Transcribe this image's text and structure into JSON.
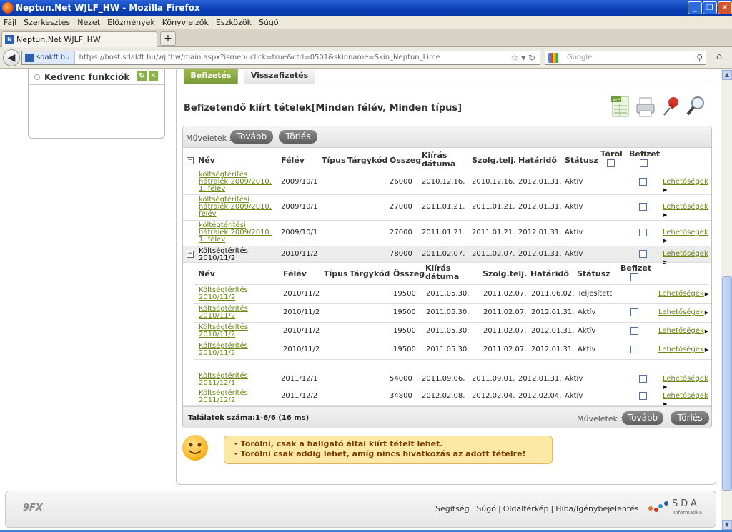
{
  "window": {
    "title": "Neptun.Net WJLF_HW - Mozilla Firefox"
  },
  "menu": [
    "Fájl",
    "Szerkesztés",
    "Nézet",
    "Előzmények",
    "Könyvjelzők",
    "Eszközök",
    "Súgó"
  ],
  "browser": {
    "tab_title": "Neptun.Net WJLF_HW",
    "new_tab": "+",
    "site_label": "sdakft.hu",
    "url": "https://host.sdakft.hu/wjlfhw/main.aspx?ismenuclick=true&ctrl=0501&skinname=Skin_Neptun_Lime",
    "search_placeholder": "Google"
  },
  "favorites": {
    "title": "Kedvenc funkciók"
  },
  "tabs": {
    "befizetes": "Befizetés",
    "visszafizetes": "Visszafizetés"
  },
  "page_title": "Befizetendő kiírt tételek[Minden félév, Minden típus]",
  "ops": {
    "label": "Műveletek :",
    "tovabb": "Tovább",
    "torles": "Törlés"
  },
  "columns": {
    "nev": "Név",
    "felev": "Félév",
    "tipus": "Típus",
    "targykod": "Tárgykód",
    "osszeg": "Összeg",
    "kiiras": "Kiírás dátuma",
    "szolg": "Szolg.telj.",
    "hatarido": "Határidő",
    "statusz": "Státusz",
    "torol": "Töröl",
    "befizet": "Befizet"
  },
  "rows": [
    {
      "name": "költségtérítés hátralék 2009/2010. 1. félév",
      "felev": "2009/10/1",
      "osszeg": "26000",
      "kiiras": "2010.12.16.",
      "szolg": "2010.12.16.",
      "hatarido": "2012.01.31.",
      "statusz": "Aktív",
      "opt": "Lehetőségek"
    },
    {
      "name": "költségtérítési hátralék 2009/2010. félév",
      "felev": "2009/10/1",
      "osszeg": "27000",
      "kiiras": "2011.01.21.",
      "szolg": "2011.01.21.",
      "hatarido": "2012.01.31.",
      "statusz": "Aktív",
      "opt": "Lehetőségek"
    },
    {
      "name": "költégtérítési hátralék 2009/2010. 1. félév",
      "felev": "2009/10/1",
      "osszeg": "27000",
      "kiiras": "2011.01.21.",
      "szolg": "2011.01.21.",
      "hatarido": "2012.01.31.",
      "statusz": "Aktív",
      "opt": "Lehetőségek"
    },
    {
      "name": "Költségtérítés 2010/11/2",
      "felev": "2010/11/2",
      "osszeg": "78000",
      "kiiras": "2011.02.07.",
      "szolg": "2011.02.07.",
      "hatarido": "2012.01.31.",
      "statusz": "Aktív",
      "opt": "Lehetőségek"
    }
  ],
  "subrows": [
    {
      "name": "Költségtérítés 2010/11/2",
      "felev": "2010/11/2",
      "osszeg": "19500",
      "kiiras": "2011.05.30.",
      "szolg": "2011.02.07.",
      "hatarido": "2011.06.02.",
      "statusz": "Teljesített",
      "opt": "Lehetőségek"
    },
    {
      "name": "Költségtérítés 2010/11/2",
      "felev": "2010/11/2",
      "osszeg": "19500",
      "kiiras": "2011.05.30.",
      "szolg": "2011.02.07.",
      "hatarido": "2012.01.31.",
      "statusz": "Aktív",
      "opt": "Lehetőségek"
    },
    {
      "name": "Költségtérítés 2010/11/2",
      "felev": "2010/11/2",
      "osszeg": "19500",
      "kiiras": "2011.05.30.",
      "szolg": "2011.02.07.",
      "hatarido": "2012.01.31.",
      "statusz": "Aktív",
      "opt": "Lehetőségek"
    },
    {
      "name": "Költségtérítés 2010/11/2",
      "felev": "2010/11/2",
      "osszeg": "19500",
      "kiiras": "2011.05.30.",
      "szolg": "2011.02.07.",
      "hatarido": "2012.01.31.",
      "statusz": "Aktív",
      "opt": "Lehetőségek"
    }
  ],
  "rows2": [
    {
      "name": "Költségtérítés 2011/12/1",
      "felev": "2011/12/1",
      "osszeg": "54000",
      "kiiras": "2011.09.06.",
      "szolg": "2011.09.01.",
      "hatarido": "2012.01.31.",
      "statusz": "Aktív",
      "opt": "Lehetőségek"
    },
    {
      "name": "Költségtérítés 2011/12/2",
      "felev": "2011/12/2",
      "osszeg": "34800",
      "kiiras": "2012.02.08.",
      "szolg": "2012.02.04.",
      "hatarido": "2012.02.04.",
      "statusz": "Aktív",
      "opt": "Lehetőségek"
    }
  ],
  "results": "Találatok száma:1-6/6 (16 ms)",
  "tip": [
    "- Törölni, csak a hallgató által kiírt tételt lehet.",
    "- Törölni csak addig lehet, amíg nincs hivatkozás az adott tételre!"
  ],
  "footer": {
    "links": [
      "Segítség",
      "Súgó",
      "Oldaltérkép",
      "Hiba/Igénybejelentés"
    ],
    "logo_left": "9FX",
    "logo_right": "SDA",
    "logo_right_sub": "Informatika"
  },
  "colors": {
    "accent": "#799a35",
    "link": "#6a8a14"
  }
}
